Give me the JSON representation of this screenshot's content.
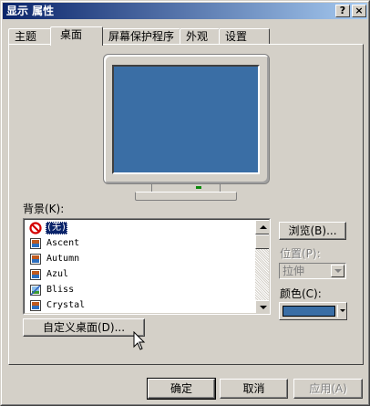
{
  "window": {
    "title": "显示 属性",
    "help_label": "?",
    "close_label": "×"
  },
  "tabs": [
    {
      "label": "主题",
      "active": false
    },
    {
      "label": "桌面",
      "active": true
    },
    {
      "label": "屏幕保护程序",
      "active": false
    },
    {
      "label": "外观",
      "active": false
    },
    {
      "label": "设置",
      "active": false
    }
  ],
  "desktop": {
    "preview_color": "#3a6ea5",
    "background_label": "背景(K):",
    "background_list": [
      {
        "label": "(无)",
        "icon": "no-symbol-icon",
        "selected": true
      },
      {
        "label": "Ascent",
        "icon": "image-file-icon",
        "selected": false
      },
      {
        "label": "Autumn",
        "icon": "image-file-icon",
        "selected": false
      },
      {
        "label": "Azul",
        "icon": "image-file-icon",
        "selected": false
      },
      {
        "label": "Bliss",
        "icon": "image-file-icon",
        "selected": false
      },
      {
        "label": "Crystal",
        "icon": "image-file-icon",
        "selected": false
      }
    ],
    "browse_label": "浏览(B)...",
    "position_label": "位置(P):",
    "position_value": "拉伸",
    "color_label": "颜色(C):",
    "color_value": "#3a6ea5",
    "customize_label": "自定义桌面(D)..."
  },
  "footer": {
    "ok_label": "确定",
    "cancel_label": "取消",
    "apply_label": "应用(A)"
  }
}
